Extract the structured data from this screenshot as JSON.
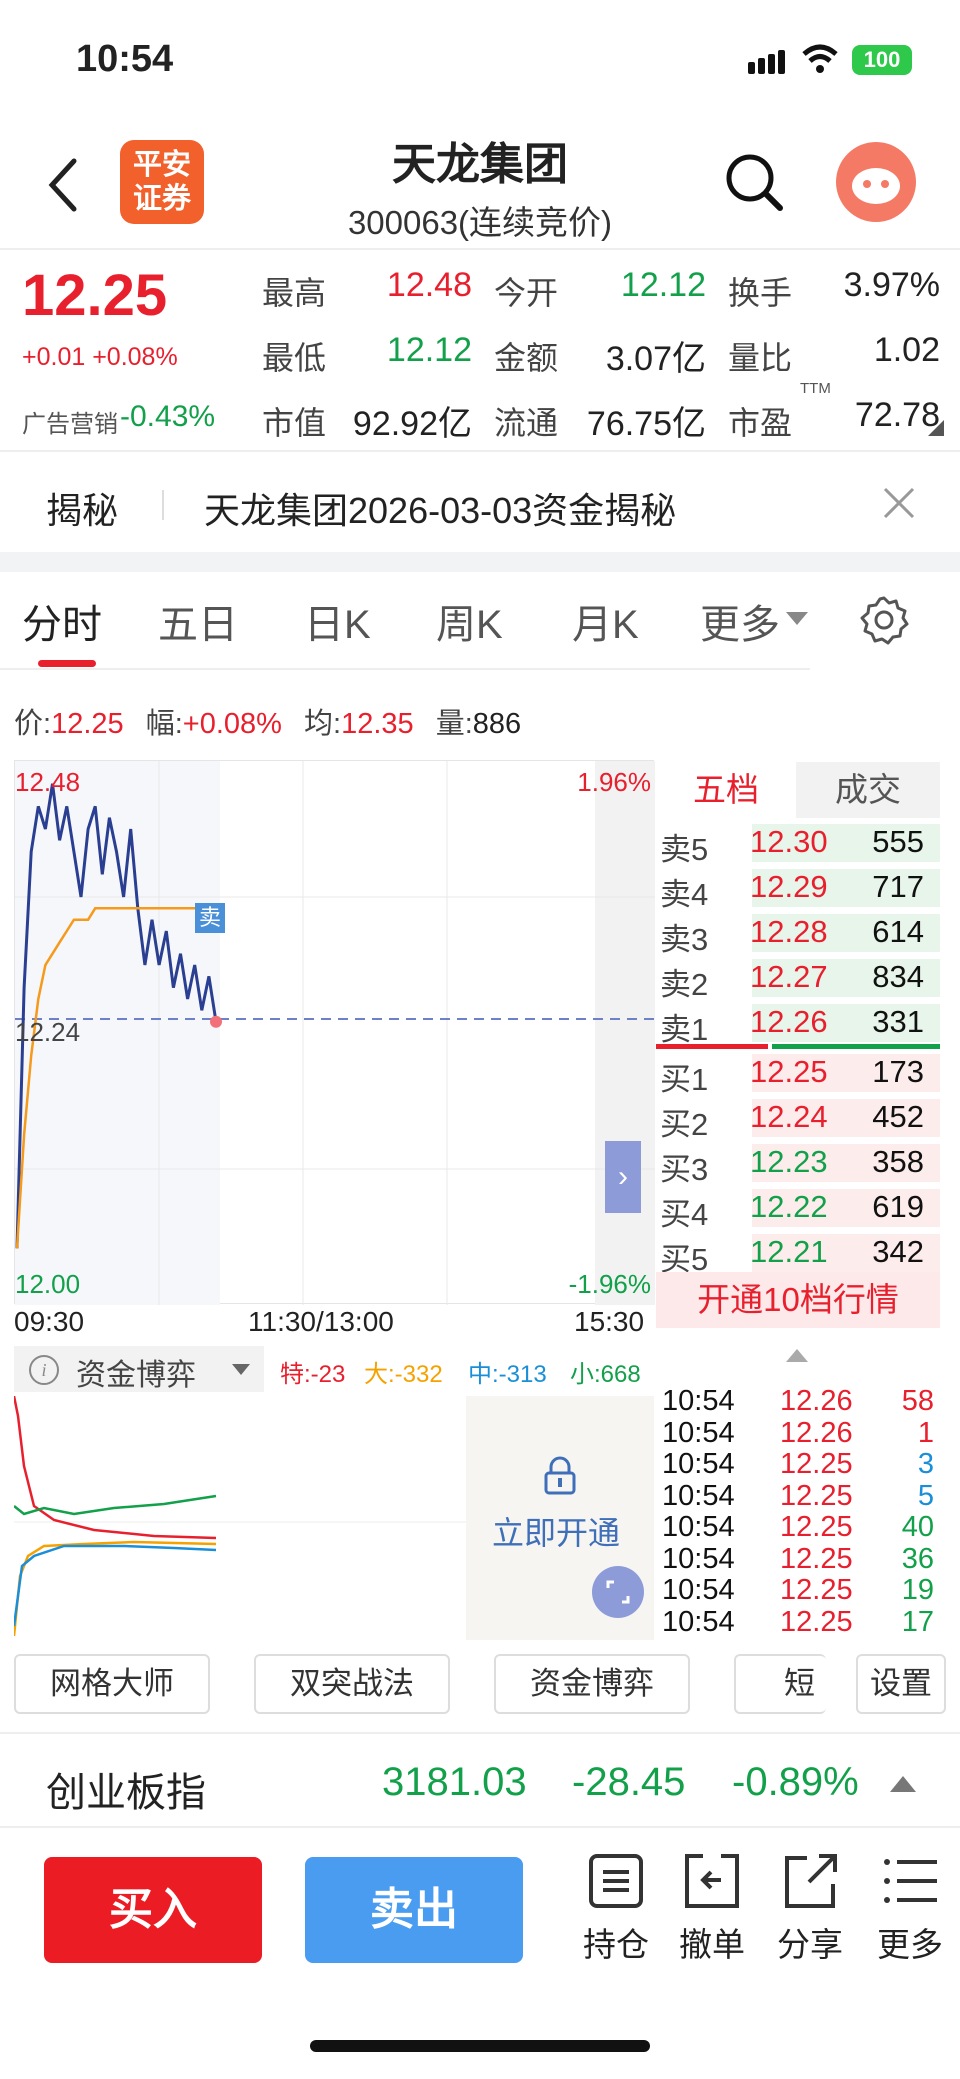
{
  "status_bar": {
    "time": "10:54",
    "battery": "100"
  },
  "header": {
    "logo_line1": "平安",
    "logo_line2": "证券",
    "stock_name": "天龙集团",
    "stock_code": "300063(连续竞价)"
  },
  "quote": {
    "price": "12.25",
    "change": "+0.01 +0.08%",
    "ad_label": "广告营销",
    "ad_value": "-0.43%",
    "high_label": "最高",
    "high": "12.48",
    "open_label": "今开",
    "open": "12.12",
    "turnover_label": "换手",
    "turnover": "3.97%",
    "low_label": "最低",
    "low": "12.12",
    "amount_label": "金额",
    "amount": "3.07亿",
    "volratio_label": "量比",
    "volratio": "1.02",
    "mcap_label": "市值",
    "mcap": "92.92亿",
    "float_label": "流通",
    "float": "76.75亿",
    "pe_label": "市盈",
    "pe_sup": "TTM",
    "pe": "72.78"
  },
  "reveal": {
    "title": "揭秘",
    "text": "天龙集团2026-03-03资金揭秘"
  },
  "tabs": [
    "分时",
    "五日",
    "日K",
    "周K",
    "月K",
    "更多"
  ],
  "info_row": {
    "price_label": "价:",
    "price": "12.25",
    "range_label": "幅:",
    "range": "+0.08%",
    "avg_label": "均:",
    "avg": "12.35",
    "vol_label": "量:",
    "vol": "886"
  },
  "chart": {
    "top_left": "12.48",
    "mid_left": "12.24",
    "bottom_left": "12.00",
    "top_right": "1.96%",
    "bottom_right": "-1.96%",
    "time_start": "09:30",
    "time_mid": "11:30/13:00",
    "time_end": "15:30",
    "sell_marker": "卖",
    "fund_title": "资金博弈",
    "fund_te": "特:-23",
    "fund_da": "大:-332",
    "fund_zhong": "中:-313",
    "fund_xiao": "小:668",
    "unlock_text": "立即开通"
  },
  "chart_data": {
    "type": "line",
    "title": "",
    "ylim": [
      12.0,
      12.48
    ],
    "series": [
      {
        "values": [
          12.05,
          12.28,
          12.4,
          12.44,
          12.42,
          12.46,
          12.41,
          12.44,
          12.4,
          12.36,
          12.42,
          12.44,
          12.38,
          12.43,
          12.4,
          12.36,
          12.42,
          12.35,
          12.3,
          12.34,
          12.3,
          12.33,
          12.28,
          12.31,
          12.27,
          12.3,
          12.26,
          12.29,
          12.25
        ]
      },
      {
        "values": [
          12.05,
          12.15,
          12.22,
          12.27,
          12.3,
          12.31,
          12.32,
          12.33,
          12.34,
          12.34,
          12.34,
          12.35,
          12.35,
          12.35,
          12.35,
          12.35,
          12.35,
          12.35,
          12.35,
          12.35,
          12.35,
          12.35,
          12.35,
          12.35,
          12.35,
          12.35,
          12.35,
          12.35,
          12.35
        ]
      }
    ]
  },
  "order_book": {
    "tab_active": "五档",
    "tab_other": "成交",
    "asks": [
      {
        "side": "卖5",
        "price": "12.30",
        "vol": "555"
      },
      {
        "side": "卖4",
        "price": "12.29",
        "vol": "717"
      },
      {
        "side": "卖3",
        "price": "12.28",
        "vol": "614"
      },
      {
        "side": "卖2",
        "price": "12.27",
        "vol": "834"
      },
      {
        "side": "卖1",
        "price": "12.26",
        "vol": "331"
      }
    ],
    "bids": [
      {
        "side": "买1",
        "price": "12.25",
        "vol": "173"
      },
      {
        "side": "买2",
        "price": "12.24",
        "vol": "452"
      },
      {
        "side": "买3",
        "price": "12.23",
        "vol": "358"
      },
      {
        "side": "买4",
        "price": "12.22",
        "vol": "619"
      },
      {
        "side": "买5",
        "price": "12.21",
        "vol": "342"
      }
    ],
    "upgrade": "开通10档行情"
  },
  "ticks": [
    {
      "time": "10:54",
      "price": "12.26",
      "vol": "58"
    },
    {
      "time": "10:54",
      "price": "12.26",
      "vol": "1"
    },
    {
      "time": "10:54",
      "price": "12.25",
      "vol": "3"
    },
    {
      "time": "10:54",
      "price": "12.25",
      "vol": "5"
    },
    {
      "time": "10:54",
      "price": "12.25",
      "vol": "40"
    },
    {
      "time": "10:54",
      "price": "12.25",
      "vol": "36"
    },
    {
      "time": "10:54",
      "price": "12.25",
      "vol": "19"
    },
    {
      "time": "10:54",
      "price": "12.25",
      "vol": "17"
    }
  ],
  "tools": [
    "网格大师",
    "双突战法",
    "资金博弈",
    "短线",
    "设置"
  ],
  "index": {
    "name": "创业板指",
    "value": "3181.03",
    "change": "-28.45",
    "pct": "-0.89%"
  },
  "actions": {
    "buy": "买入",
    "sell": "卖出",
    "hold": "持仓",
    "cancel": "撤单",
    "share": "分享",
    "more": "更多"
  }
}
